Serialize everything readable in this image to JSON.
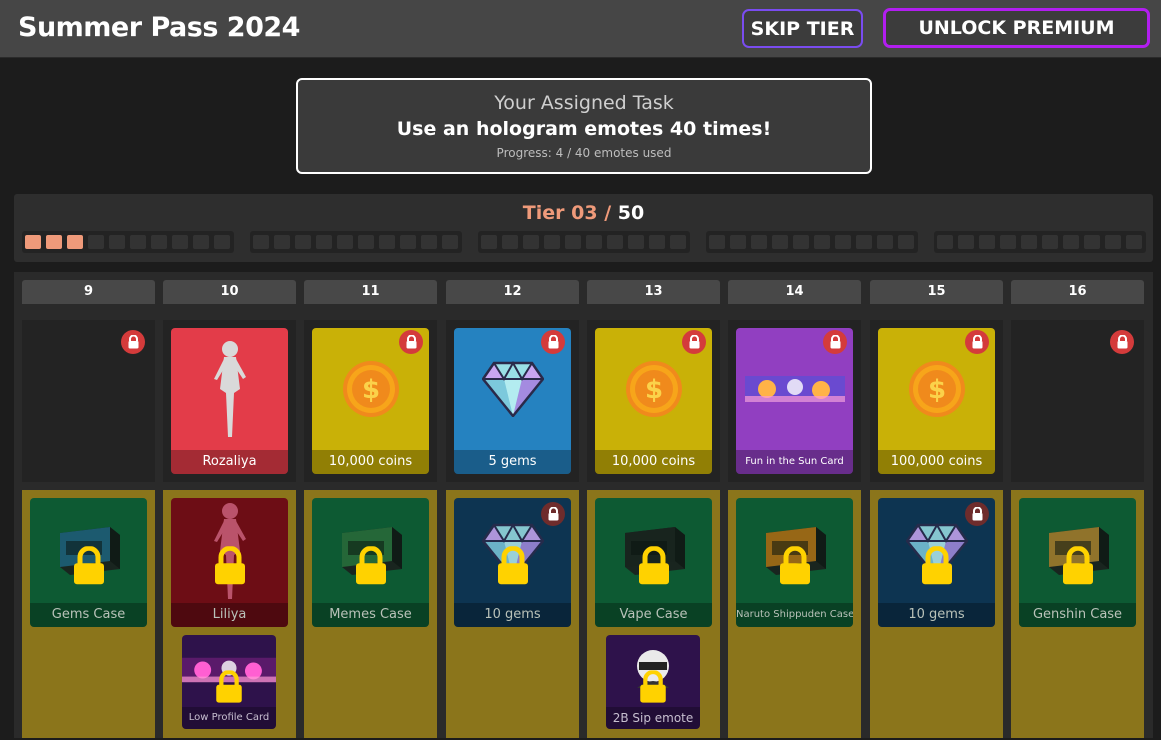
{
  "header": {
    "title": "Summer Pass 2024",
    "skip_label": "SKIP TIER",
    "unlock_label": "UNLOCK PREMIUM"
  },
  "task": {
    "heading": "Your Assigned Task",
    "description": "Use an hologram emotes 40 times!",
    "progress": "Progress: 4 / 40 emotes used",
    "current": 4,
    "total": 40
  },
  "tier": {
    "current": "Tier 03",
    "separator": " / ",
    "total": "50",
    "completed": 3
  },
  "columns": [
    {
      "num": "9",
      "free": {
        "label": "",
        "art": "empty",
        "locked": true
      },
      "premium": {
        "label": "Gems Case",
        "art": "gems-case",
        "locked": true
      }
    },
    {
      "num": "10",
      "free": {
        "label": "Rozaliya",
        "art": "character-rozaliya",
        "locked": false
      },
      "premium": {
        "label": "Liliya",
        "art": "character-liliya",
        "locked": true
      },
      "extra": {
        "label": "Low Profile Card",
        "art": "low-profile-card",
        "locked": true
      }
    },
    {
      "num": "11",
      "free": {
        "label": "10,000 coins",
        "art": "coin",
        "locked": true
      },
      "premium": {
        "label": "Memes Case",
        "art": "memes-case",
        "locked": true
      }
    },
    {
      "num": "12",
      "free": {
        "label": "5 gems",
        "art": "gem",
        "locked": true
      },
      "premium": {
        "label": "10 gems",
        "art": "gem",
        "locked": true,
        "badge": true
      }
    },
    {
      "num": "13",
      "free": {
        "label": "10,000 coins",
        "art": "coin",
        "locked": true
      },
      "premium": {
        "label": "Vape Case",
        "art": "vape-case",
        "locked": true
      },
      "extra": {
        "label": "2B Sip emote",
        "art": "2b-sip-emote",
        "locked": true
      }
    },
    {
      "num": "14",
      "free": {
        "label": "Fun in the Sun Card",
        "art": "fun-in-the-sun-card",
        "locked": true
      },
      "premium": {
        "label": "Naruto Shippuden Case",
        "art": "naruto-case",
        "locked": true
      }
    },
    {
      "num": "15",
      "free": {
        "label": "100,000 coins",
        "art": "coin",
        "locked": true
      },
      "premium": {
        "label": "10 gems",
        "art": "gem",
        "locked": true,
        "badge": true
      }
    },
    {
      "num": "16",
      "free": {
        "label": "",
        "art": "empty",
        "locked": true
      },
      "premium": {
        "label": "Genshin Case",
        "art": "genshin-case",
        "locked": true
      }
    }
  ],
  "colors": {
    "accent": "#ef9a7a",
    "lock_badge": "#d43b3b",
    "premium_bg": "#8b751b",
    "unlock_border": "#b21ef0",
    "skip_border": "#7a4cf0"
  }
}
